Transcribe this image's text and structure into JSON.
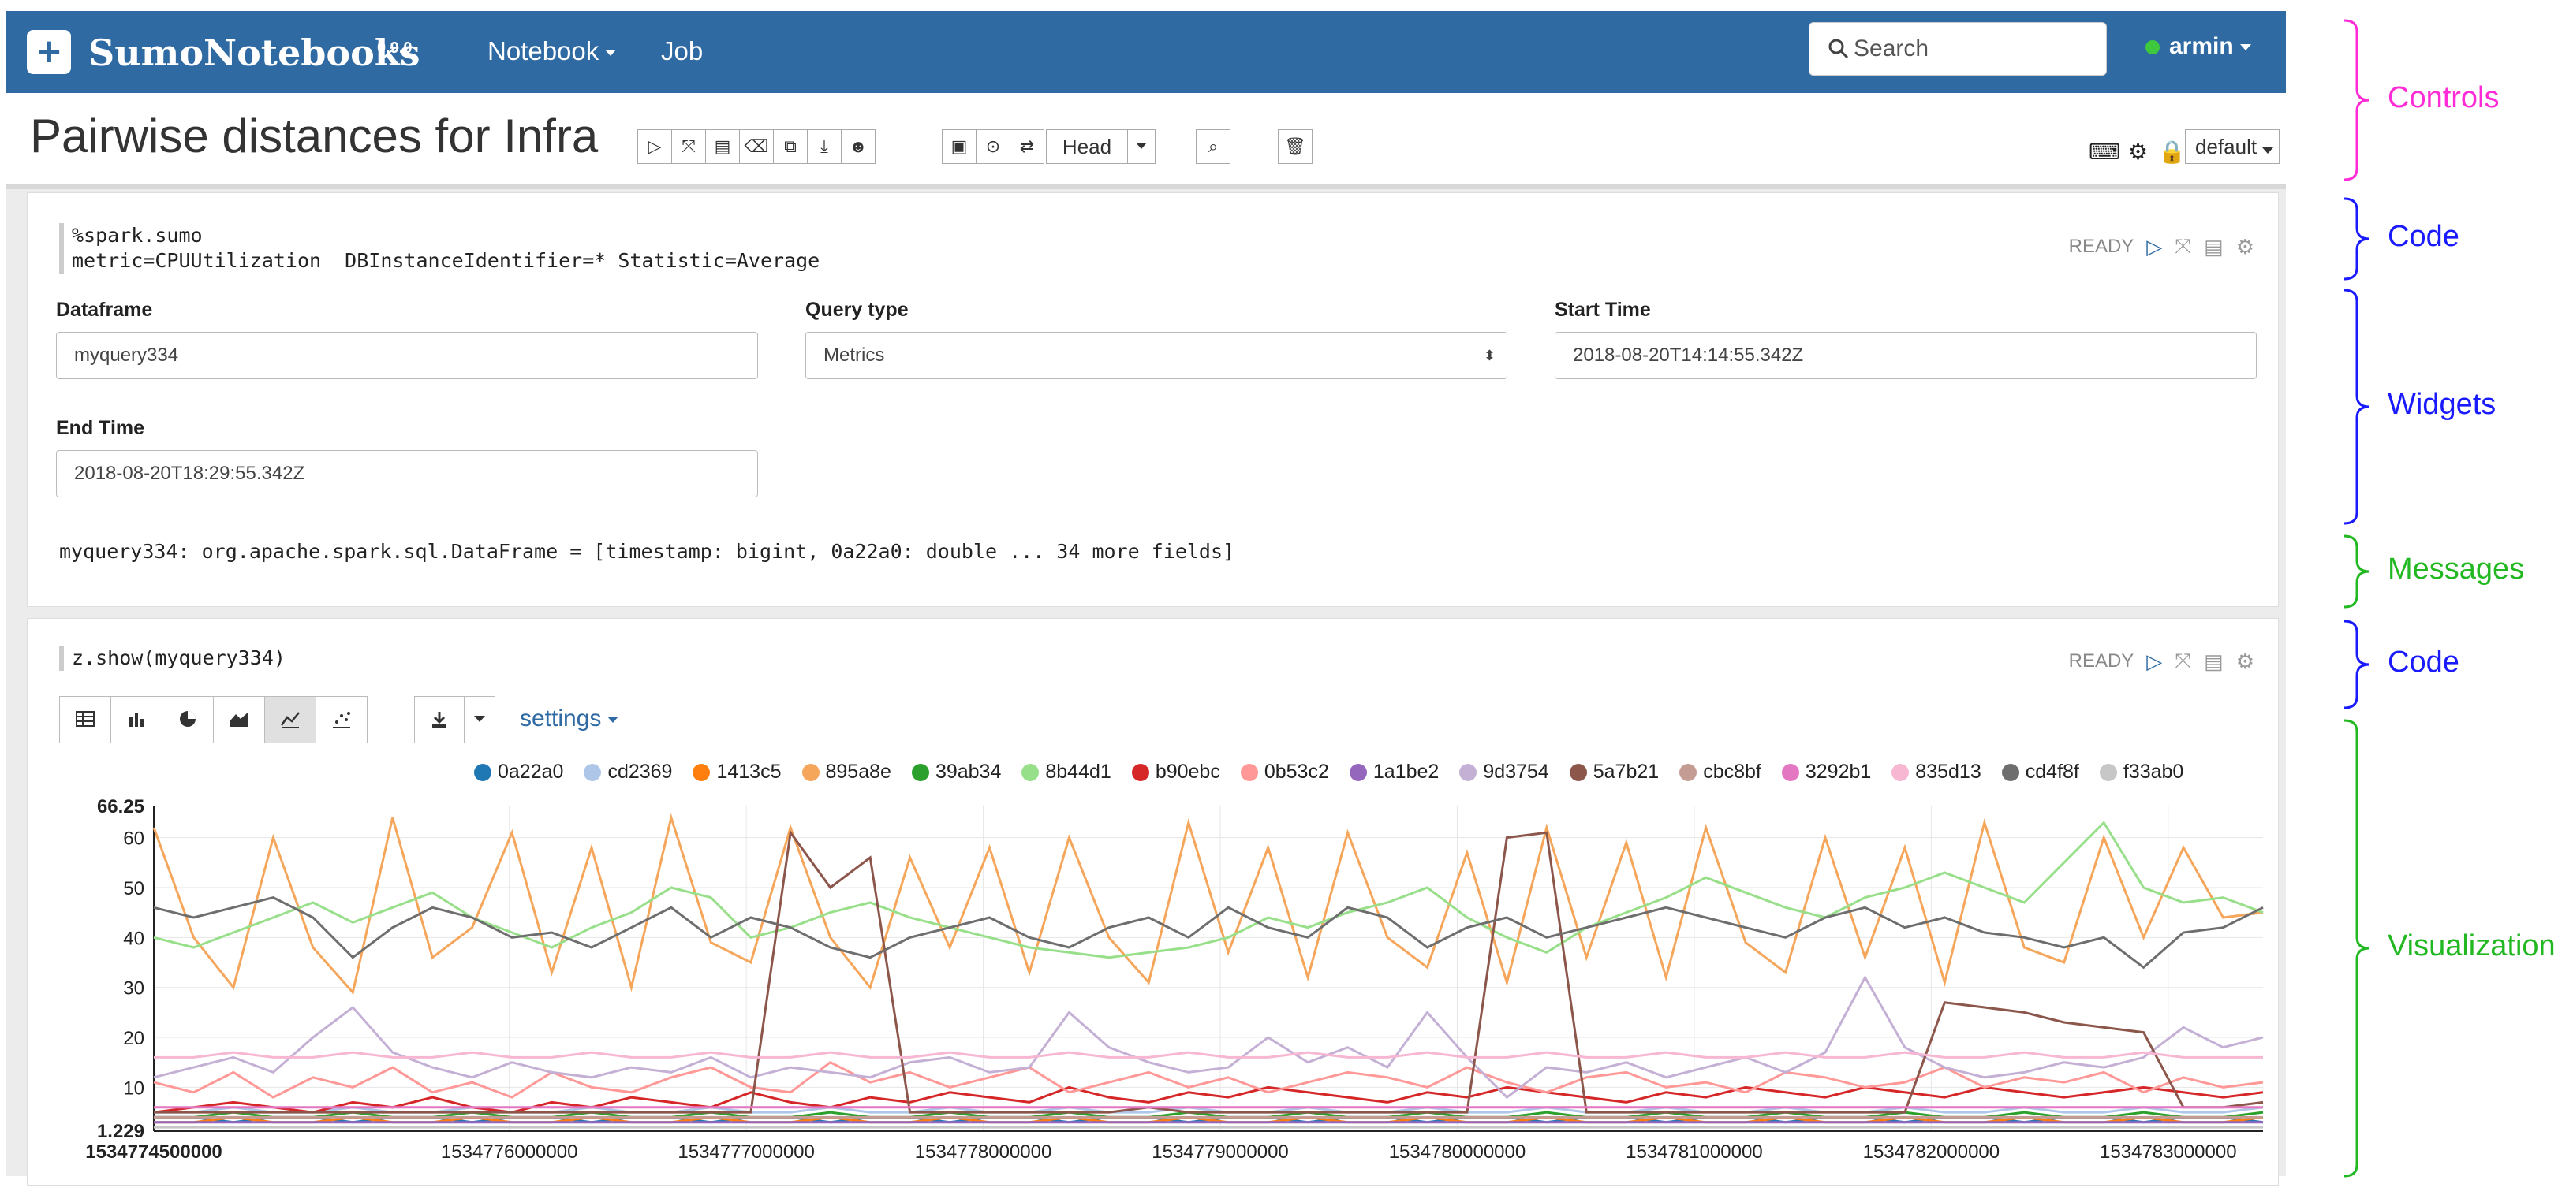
{
  "navbar": {
    "brand": "SumoNotebooks",
    "version": "0.9.0",
    "menus": [
      {
        "label": "Notebook"
      },
      {
        "label": "Job"
      }
    ],
    "search_placeholder": "Search",
    "user": "armin"
  },
  "titlebar": {
    "title": "Pairwise distances for Infra",
    "head_label": "Head",
    "interpreter": "default"
  },
  "paragraph1": {
    "code_line1": "%spark.sumo",
    "code_line2": "metric=CPUUtilization  DBInstanceIdentifier=* Statistic=Average",
    "status": "READY",
    "widgets": {
      "dataframe_label": "Dataframe",
      "dataframe_value": "myquery334",
      "query_type_label": "Query type",
      "query_type_value": "Metrics",
      "start_time_label": "Start Time",
      "start_time_value": "2018-08-20T14:14:55.342Z",
      "end_time_label": "End Time",
      "end_time_value": "2018-08-20T18:29:55.342Z"
    },
    "message": "myquery334: org.apache.spark.sql.DataFrame = [timestamp: bigint, 0a22a0: double ... 34 more fields]"
  },
  "paragraph2": {
    "code": "z.show(myquery334)",
    "status": "READY",
    "settings_label": "settings"
  },
  "chart_data": {
    "type": "line",
    "ylim": [
      1.229,
      66.25
    ],
    "y_ticks": [
      "60",
      "50",
      "40",
      "30",
      "20",
      "10"
    ],
    "y_max_label": "66.25",
    "y_min_label": "1.229",
    "x_ticks": [
      "1534774500000",
      "1534776000000",
      "1534777000000",
      "1534778000000",
      "1534779000000",
      "1534780000000",
      "1534781000000",
      "1534782000000",
      "1534783000000"
    ],
    "xlim": [
      1534774500000,
      1534783400000
    ],
    "series": [
      {
        "name": "0a22a0",
        "color": "#1f77b4",
        "values": [
          4,
          4,
          3,
          4,
          4,
          3,
          4,
          4,
          3,
          4,
          4,
          3,
          4,
          4,
          3,
          4,
          4,
          3,
          4,
          4,
          3,
          4,
          4,
          3,
          4,
          4,
          3,
          4,
          4,
          3,
          4,
          4,
          3,
          4,
          4,
          3,
          4,
          4,
          3,
          4,
          4,
          3,
          4,
          4,
          3,
          4,
          4,
          3,
          4,
          4,
          3,
          4,
          4,
          3
        ]
      },
      {
        "name": "cd2369",
        "color": "#aec7e8",
        "values": [
          5,
          5,
          6,
          5,
          5,
          6,
          5,
          5,
          6,
          5,
          5,
          6,
          5,
          5,
          6,
          5,
          5,
          6,
          5,
          5,
          6,
          5,
          5,
          6,
          5,
          5,
          6,
          5,
          5,
          6,
          5,
          5,
          6,
          5,
          5,
          6,
          5,
          5,
          6,
          5,
          5,
          6,
          5,
          5,
          6,
          5,
          5,
          6,
          5,
          5,
          6,
          5,
          5,
          6
        ]
      },
      {
        "name": "1413c5",
        "color": "#ff7f0e",
        "values": [
          3,
          3,
          4,
          3,
          3,
          4,
          3,
          3,
          4,
          3,
          3,
          4,
          3,
          3,
          4,
          3,
          3,
          4,
          3,
          3,
          4,
          3,
          3,
          4,
          3,
          3,
          4,
          3,
          3,
          4,
          3,
          3,
          4,
          3,
          3,
          4,
          3,
          3,
          4,
          3,
          3,
          4,
          3,
          3,
          4,
          3,
          3,
          4,
          3,
          3,
          4,
          3,
          3,
          4
        ]
      },
      {
        "name": "895a8e",
        "color": "#f5a65b",
        "values": [
          62,
          40,
          30,
          60,
          38,
          29,
          64,
          36,
          42,
          61,
          33,
          58,
          30,
          64,
          39,
          35,
          62,
          40,
          30,
          56,
          38,
          58,
          33,
          60,
          40,
          31,
          63,
          37,
          58,
          32,
          61,
          40,
          34,
          57,
          31,
          62,
          36,
          59,
          32,
          62,
          39,
          33,
          60,
          36,
          58,
          31,
          63,
          38,
          35,
          60,
          40,
          58,
          44,
          45
        ]
      },
      {
        "name": "39ab34",
        "color": "#2ca02c",
        "values": [
          4,
          4,
          5,
          4,
          4,
          5,
          4,
          4,
          5,
          4,
          4,
          5,
          4,
          4,
          5,
          4,
          4,
          5,
          4,
          4,
          5,
          4,
          4,
          5,
          4,
          4,
          5,
          4,
          4,
          5,
          4,
          4,
          5,
          4,
          4,
          5,
          4,
          4,
          5,
          4,
          4,
          5,
          4,
          4,
          5,
          4,
          4,
          5,
          4,
          4,
          5,
          4,
          4,
          5
        ]
      },
      {
        "name": "8b44d1",
        "color": "#98df8a",
        "values": [
          40,
          38,
          41,
          44,
          47,
          43,
          46,
          49,
          44,
          41,
          38,
          42,
          45,
          50,
          48,
          40,
          42,
          45,
          47,
          44,
          42,
          40,
          38,
          37,
          36,
          37,
          38,
          40,
          44,
          42,
          45,
          47,
          50,
          44,
          40,
          37,
          42,
          45,
          48,
          52,
          49,
          46,
          44,
          48,
          50,
          53,
          50,
          47,
          55,
          63,
          50,
          47,
          48,
          45
        ]
      },
      {
        "name": "b90ebc",
        "color": "#d62728",
        "values": [
          5,
          6,
          7,
          6,
          5,
          7,
          6,
          8,
          6,
          5,
          7,
          6,
          8,
          7,
          6,
          9,
          7,
          6,
          8,
          7,
          9,
          8,
          7,
          10,
          8,
          7,
          9,
          8,
          10,
          9,
          8,
          7,
          9,
          8,
          10,
          9,
          8,
          7,
          9,
          8,
          10,
          9,
          8,
          10,
          9,
          8,
          10,
          9,
          8,
          9,
          10,
          9,
          8,
          9
        ]
      },
      {
        "name": "0b53c2",
        "color": "#ff9896",
        "values": [
          11,
          9,
          13,
          8,
          12,
          10,
          14,
          9,
          11,
          8,
          13,
          10,
          9,
          12,
          14,
          10,
          9,
          15,
          11,
          13,
          10,
          12,
          14,
          9,
          11,
          13,
          10,
          12,
          9,
          11,
          13,
          12,
          10,
          14,
          11,
          9,
          12,
          13,
          10,
          11,
          9,
          13,
          12,
          10,
          11,
          14,
          10,
          12,
          11,
          13,
          9,
          12,
          10,
          11
        ]
      },
      {
        "name": "1a1be2",
        "color": "#9467bd",
        "values": [
          3,
          3,
          3,
          3,
          3,
          3,
          3,
          3,
          3,
          3,
          3,
          3,
          3,
          3,
          3,
          3,
          3,
          3,
          3,
          3,
          3,
          3,
          3,
          3,
          3,
          3,
          3,
          3,
          3,
          3,
          3,
          3,
          3,
          3,
          3,
          3,
          3,
          3,
          3,
          3,
          3,
          3,
          3,
          3,
          3,
          3,
          3,
          3,
          3,
          3,
          3,
          3,
          3,
          3
        ]
      },
      {
        "name": "9d3754",
        "color": "#c5b0d5",
        "values": [
          12,
          14,
          16,
          13,
          20,
          26,
          17,
          14,
          12,
          15,
          13,
          12,
          14,
          13,
          16,
          12,
          14,
          13,
          12,
          15,
          16,
          13,
          14,
          25,
          18,
          15,
          13,
          14,
          20,
          15,
          18,
          14,
          25,
          16,
          8,
          14,
          13,
          15,
          12,
          14,
          16,
          13,
          17,
          32,
          18,
          14,
          12,
          13,
          15,
          14,
          16,
          22,
          18,
          20
        ]
      },
      {
        "name": "5a7b21",
        "color": "#8c564b",
        "values": [
          5,
          5,
          5,
          5,
          5,
          5,
          5,
          5,
          5,
          5,
          5,
          5,
          5,
          5,
          5,
          5,
          61,
          50,
          56,
          5,
          5,
          5,
          5,
          5,
          5,
          6,
          5,
          5,
          5,
          5,
          5,
          5,
          5,
          5,
          60,
          61,
          5,
          5,
          5,
          5,
          5,
          5,
          5,
          5,
          5,
          27,
          26,
          25,
          23,
          22,
          21,
          6,
          6,
          7
        ]
      },
      {
        "name": "cbc8bf",
        "color": "#c49c94",
        "values": [
          4,
          4,
          4,
          4,
          4,
          4,
          4,
          4,
          4,
          4,
          4,
          4,
          4,
          4,
          4,
          4,
          4,
          4,
          4,
          4,
          4,
          4,
          4,
          4,
          4,
          4,
          4,
          4,
          4,
          4,
          4,
          4,
          4,
          4,
          4,
          4,
          4,
          4,
          4,
          4,
          4,
          4,
          4,
          4,
          4,
          4,
          4,
          4,
          4,
          4,
          4,
          4,
          4,
          4
        ]
      },
      {
        "name": "3292b1",
        "color": "#e377c2",
        "values": [
          6,
          6,
          6,
          6,
          6,
          6,
          6,
          6,
          6,
          6,
          6,
          6,
          6,
          6,
          6,
          6,
          6,
          6,
          6,
          6,
          6,
          6,
          6,
          6,
          6,
          6,
          6,
          6,
          6,
          6,
          6,
          6,
          6,
          6,
          6,
          6,
          6,
          6,
          6,
          6,
          6,
          6,
          6,
          6,
          6,
          6,
          6,
          6,
          6,
          6,
          6,
          6,
          6,
          6
        ]
      },
      {
        "name": "835d13",
        "color": "#f7b6d2",
        "values": [
          16,
          16,
          17,
          16,
          16,
          17,
          16,
          16,
          17,
          16,
          16,
          17,
          16,
          16,
          17,
          16,
          16,
          17,
          16,
          16,
          17,
          16,
          16,
          17,
          16,
          16,
          17,
          16,
          16,
          17,
          16,
          16,
          17,
          16,
          16,
          17,
          16,
          16,
          17,
          16,
          16,
          17,
          16,
          16,
          17,
          16,
          16,
          17,
          16,
          16,
          17,
          16,
          16,
          16
        ]
      },
      {
        "name": "cd4f8f",
        "color": "#6e6e6e",
        "values": [
          46,
          44,
          46,
          48,
          44,
          36,
          42,
          46,
          44,
          40,
          41,
          38,
          42,
          46,
          40,
          44,
          42,
          38,
          36,
          40,
          42,
          44,
          40,
          38,
          42,
          44,
          40,
          46,
          42,
          40,
          46,
          44,
          38,
          42,
          44,
          40,
          42,
          44,
          46,
          44,
          42,
          40,
          44,
          46,
          42,
          44,
          41,
          40,
          38,
          40,
          34,
          41,
          42,
          46
        ]
      },
      {
        "name": "f33ab0",
        "color": "#c7c7c7",
        "values": [
          2,
          2,
          2,
          2,
          2,
          2,
          2,
          2,
          2,
          2,
          2,
          2,
          2,
          2,
          2,
          2,
          2,
          2,
          2,
          2,
          2,
          2,
          2,
          2,
          2,
          2,
          2,
          2,
          2,
          2,
          2,
          2,
          2,
          2,
          2,
          2,
          2,
          2,
          2,
          2,
          2,
          2,
          2,
          2,
          2,
          2,
          2,
          2,
          2,
          2,
          2,
          2,
          2,
          2
        ]
      }
    ]
  },
  "annotations": [
    {
      "label": "Controls",
      "color": "#ff2bd6"
    },
    {
      "label": "Code",
      "color": "#1a1aff"
    },
    {
      "label": "Widgets",
      "color": "#1a1aff"
    },
    {
      "label": "Messages",
      "color": "#22b822"
    },
    {
      "label": "Code",
      "color": "#1a1aff"
    },
    {
      "label": "Visualization",
      "color": "#22b822"
    }
  ]
}
